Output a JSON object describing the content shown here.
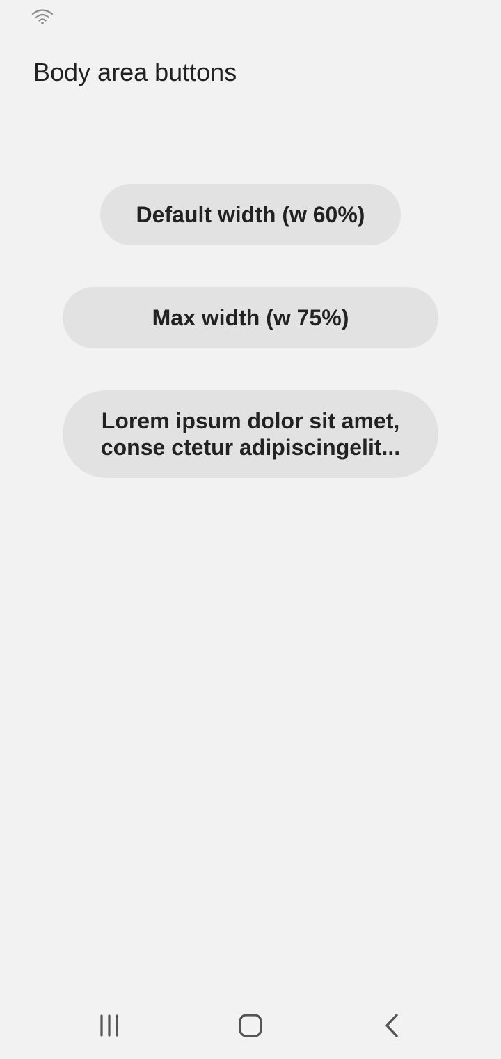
{
  "status_bar": {
    "wifi_icon": "wifi-icon"
  },
  "header": {
    "title": "Body area buttons"
  },
  "buttons": [
    {
      "label": "Default width (w 60%)"
    },
    {
      "label": "Max width (w 75%)"
    },
    {
      "label": "Lorem ipsum dolor sit amet, conse ctetur adipiscingelit..."
    }
  ],
  "nav_bar": {
    "recents_icon": "recents-icon",
    "home_icon": "home-icon",
    "back_icon": "back-icon"
  },
  "colors": {
    "background": "#f2f2f2",
    "button_background": "#e2e2e2",
    "text": "#222222",
    "icon": "#555555"
  }
}
